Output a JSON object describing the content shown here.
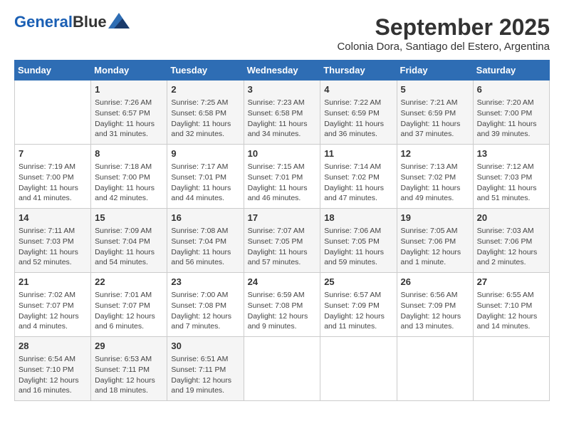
{
  "logo": {
    "line1": "General",
    "line2": "Blue"
  },
  "title": "September 2025",
  "subtitle": "Colonia Dora, Santiago del Estero, Argentina",
  "headers": [
    "Sunday",
    "Monday",
    "Tuesday",
    "Wednesday",
    "Thursday",
    "Friday",
    "Saturday"
  ],
  "weeks": [
    [
      {
        "day": "",
        "content": ""
      },
      {
        "day": "1",
        "content": "Sunrise: 7:26 AM\nSunset: 6:57 PM\nDaylight: 11 hours\nand 31 minutes."
      },
      {
        "day": "2",
        "content": "Sunrise: 7:25 AM\nSunset: 6:58 PM\nDaylight: 11 hours\nand 32 minutes."
      },
      {
        "day": "3",
        "content": "Sunrise: 7:23 AM\nSunset: 6:58 PM\nDaylight: 11 hours\nand 34 minutes."
      },
      {
        "day": "4",
        "content": "Sunrise: 7:22 AM\nSunset: 6:59 PM\nDaylight: 11 hours\nand 36 minutes."
      },
      {
        "day": "5",
        "content": "Sunrise: 7:21 AM\nSunset: 6:59 PM\nDaylight: 11 hours\nand 37 minutes."
      },
      {
        "day": "6",
        "content": "Sunrise: 7:20 AM\nSunset: 7:00 PM\nDaylight: 11 hours\nand 39 minutes."
      }
    ],
    [
      {
        "day": "7",
        "content": "Sunrise: 7:19 AM\nSunset: 7:00 PM\nDaylight: 11 hours\nand 41 minutes."
      },
      {
        "day": "8",
        "content": "Sunrise: 7:18 AM\nSunset: 7:00 PM\nDaylight: 11 hours\nand 42 minutes."
      },
      {
        "day": "9",
        "content": "Sunrise: 7:17 AM\nSunset: 7:01 PM\nDaylight: 11 hours\nand 44 minutes."
      },
      {
        "day": "10",
        "content": "Sunrise: 7:15 AM\nSunset: 7:01 PM\nDaylight: 11 hours\nand 46 minutes."
      },
      {
        "day": "11",
        "content": "Sunrise: 7:14 AM\nSunset: 7:02 PM\nDaylight: 11 hours\nand 47 minutes."
      },
      {
        "day": "12",
        "content": "Sunrise: 7:13 AM\nSunset: 7:02 PM\nDaylight: 11 hours\nand 49 minutes."
      },
      {
        "day": "13",
        "content": "Sunrise: 7:12 AM\nSunset: 7:03 PM\nDaylight: 11 hours\nand 51 minutes."
      }
    ],
    [
      {
        "day": "14",
        "content": "Sunrise: 7:11 AM\nSunset: 7:03 PM\nDaylight: 11 hours\nand 52 minutes."
      },
      {
        "day": "15",
        "content": "Sunrise: 7:09 AM\nSunset: 7:04 PM\nDaylight: 11 hours\nand 54 minutes."
      },
      {
        "day": "16",
        "content": "Sunrise: 7:08 AM\nSunset: 7:04 PM\nDaylight: 11 hours\nand 56 minutes."
      },
      {
        "day": "17",
        "content": "Sunrise: 7:07 AM\nSunset: 7:05 PM\nDaylight: 11 hours\nand 57 minutes."
      },
      {
        "day": "18",
        "content": "Sunrise: 7:06 AM\nSunset: 7:05 PM\nDaylight: 11 hours\nand 59 minutes."
      },
      {
        "day": "19",
        "content": "Sunrise: 7:05 AM\nSunset: 7:06 PM\nDaylight: 12 hours\nand 1 minute."
      },
      {
        "day": "20",
        "content": "Sunrise: 7:03 AM\nSunset: 7:06 PM\nDaylight: 12 hours\nand 2 minutes."
      }
    ],
    [
      {
        "day": "21",
        "content": "Sunrise: 7:02 AM\nSunset: 7:07 PM\nDaylight: 12 hours\nand 4 minutes."
      },
      {
        "day": "22",
        "content": "Sunrise: 7:01 AM\nSunset: 7:07 PM\nDaylight: 12 hours\nand 6 minutes."
      },
      {
        "day": "23",
        "content": "Sunrise: 7:00 AM\nSunset: 7:08 PM\nDaylight: 12 hours\nand 7 minutes."
      },
      {
        "day": "24",
        "content": "Sunrise: 6:59 AM\nSunset: 7:08 PM\nDaylight: 12 hours\nand 9 minutes."
      },
      {
        "day": "25",
        "content": "Sunrise: 6:57 AM\nSunset: 7:09 PM\nDaylight: 12 hours\nand 11 minutes."
      },
      {
        "day": "26",
        "content": "Sunrise: 6:56 AM\nSunset: 7:09 PM\nDaylight: 12 hours\nand 13 minutes."
      },
      {
        "day": "27",
        "content": "Sunrise: 6:55 AM\nSunset: 7:10 PM\nDaylight: 12 hours\nand 14 minutes."
      }
    ],
    [
      {
        "day": "28",
        "content": "Sunrise: 6:54 AM\nSunset: 7:10 PM\nDaylight: 12 hours\nand 16 minutes."
      },
      {
        "day": "29",
        "content": "Sunrise: 6:53 AM\nSunset: 7:11 PM\nDaylight: 12 hours\nand 18 minutes."
      },
      {
        "day": "30",
        "content": "Sunrise: 6:51 AM\nSunset: 7:11 PM\nDaylight: 12 hours\nand 19 minutes."
      },
      {
        "day": "",
        "content": ""
      },
      {
        "day": "",
        "content": ""
      },
      {
        "day": "",
        "content": ""
      },
      {
        "day": "",
        "content": ""
      }
    ]
  ]
}
